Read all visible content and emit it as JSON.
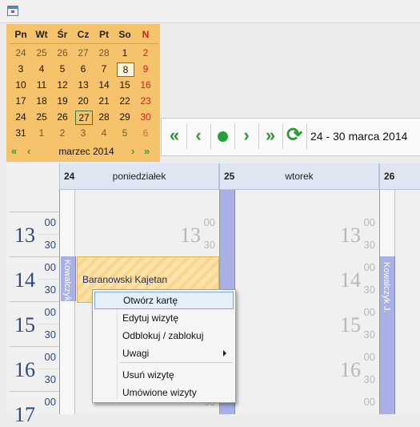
{
  "mini_calendar": {
    "weekdays": [
      "Pn",
      "Wt",
      "Śr",
      "Cz",
      "Pt",
      "So",
      "N"
    ],
    "weeks": [
      [
        "24",
        "25",
        "26",
        "27",
        "28",
        "1",
        "2"
      ],
      [
        "3",
        "4",
        "5",
        "6",
        "7",
        "8",
        "9"
      ],
      [
        "10",
        "11",
        "12",
        "13",
        "14",
        "15",
        "16"
      ],
      [
        "17",
        "18",
        "19",
        "20",
        "21",
        "22",
        "23"
      ],
      [
        "24",
        "25",
        "26",
        "27",
        "28",
        "29",
        "30"
      ],
      [
        "31",
        "1",
        "2",
        "3",
        "4",
        "5",
        "6"
      ]
    ],
    "month_label": "marzec 2014",
    "prev_year_icon": "«",
    "prev_month_icon": "‹",
    "next_month_icon": "›",
    "next_year_icon": "»"
  },
  "toolbar": {
    "first_icon": "«",
    "prev_icon": "‹",
    "next_icon": "›",
    "last_icon": "»",
    "refresh_icon": "⟳",
    "range_label": "24 - 30 marca 2014"
  },
  "grid": {
    "days": [
      {
        "num": "24",
        "name": "poniedziałek"
      },
      {
        "num": "25",
        "name": "wtorek"
      },
      {
        "num": "26",
        "name": ""
      }
    ],
    "hours": [
      "13",
      "14",
      "15",
      "16",
      "17"
    ],
    "minutes": [
      "00",
      "30"
    ],
    "resource_label": "Kowalczyk J."
  },
  "appointment": {
    "patient": "Baranowski Kajetan"
  },
  "context_menu": {
    "items": [
      {
        "label": "Otwórz kartę"
      },
      {
        "label": "Edytuj wizytę"
      },
      {
        "label": "Odblokuj / zablokuj"
      },
      {
        "label": "Uwagi"
      },
      {
        "label": "Usuń wizytę"
      },
      {
        "label": "Umówione wizyty"
      }
    ]
  },
  "colors": {
    "calendar_bg": "#f4c36b",
    "sunday_red": "#d62020",
    "accent_green": "#2e9a3a",
    "resource_blue": "#a9b0e6",
    "hour_text": "#2a4a7f",
    "header_bg": "#dfe6f1"
  }
}
